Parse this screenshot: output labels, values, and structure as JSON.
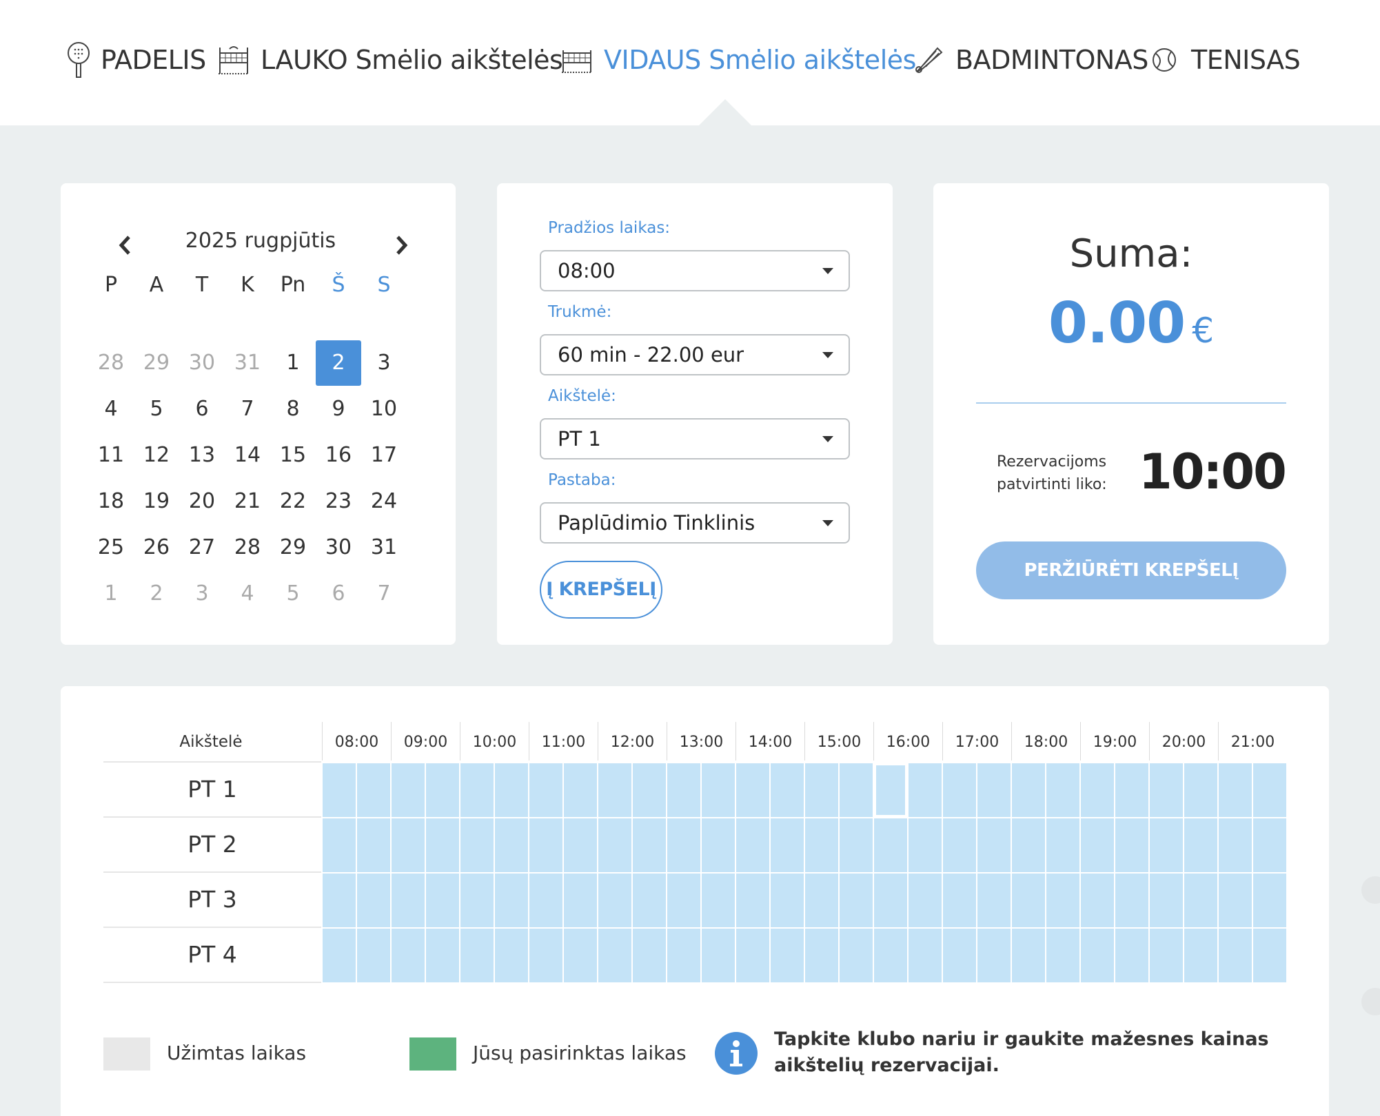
{
  "nav": {
    "items": [
      {
        "label": "PADELIS",
        "icon": "padel-racket-icon"
      },
      {
        "label": "LAUKO Smėlio aikštelės",
        "icon": "volleyball-net-icon"
      },
      {
        "label": "VIDAUS Smėlio aikštelės",
        "icon": "volleyball-net-icon",
        "active": true
      },
      {
        "label": "BADMINTONAS",
        "icon": "shuttlecock-icon"
      },
      {
        "label": "TENISAS",
        "icon": "tennis-ball-icon"
      }
    ]
  },
  "calendar": {
    "title": "2025 rugpjūtis",
    "weekdays": [
      "P",
      "A",
      "T",
      "K",
      "Pn",
      "Š",
      "S"
    ],
    "selected_day": "2",
    "weeks": [
      [
        "28",
        "29",
        "30",
        "31",
        "1",
        "2",
        "3"
      ],
      [
        "4",
        "5",
        "6",
        "7",
        "8",
        "9",
        "10"
      ],
      [
        "11",
        "12",
        "13",
        "14",
        "15",
        "16",
        "17"
      ],
      [
        "18",
        "19",
        "20",
        "21",
        "22",
        "23",
        "24"
      ],
      [
        "25",
        "26",
        "27",
        "28",
        "29",
        "30",
        "31"
      ],
      [
        "1",
        "2",
        "3",
        "4",
        "5",
        "6",
        "7"
      ]
    ]
  },
  "form": {
    "start_label": "Pradžios laikas:",
    "start_value": "08:00",
    "duration_label": "Trukmė:",
    "duration_value": "60 min - 22.00 eur",
    "court_label": "Aikštelė:",
    "court_value": "PT 1",
    "note_label": "Pastaba:",
    "note_value": "Paplūdimio Tinklinis",
    "add_button": "Į KREPŠELĮ"
  },
  "summary": {
    "label": "Suma:",
    "amount": "0.00",
    "currency": "€",
    "timer_label_1": "Rezervacijoms",
    "timer_label_2": "patvirtinti liko:",
    "timer": "10:00",
    "view_button": "PERŽIŪRĖTI KREPŠELĮ"
  },
  "schedule": {
    "court_header": "Aikštelė",
    "times": [
      "08:00",
      "09:00",
      "10:00",
      "11:00",
      "12:00",
      "13:00",
      "14:00",
      "15:00",
      "16:00",
      "17:00",
      "18:00",
      "19:00",
      "20:00",
      "21:00"
    ],
    "courts": [
      "PT 1",
      "PT 2",
      "PT 3",
      "PT 4"
    ],
    "highlighted_slot": {
      "court": "PT 1",
      "time": "16:00"
    }
  },
  "legend": {
    "busy": "Užimtas laikas",
    "busy_color": "#e8e8e8",
    "selected": "Jūsų pasirinktas laikas",
    "selected_color": "#5db37e",
    "info": "Tapkite klubo nariu ir gaukite mažesnes kainas aikštelių rezervacijai."
  },
  "colors": {
    "accent": "#4a90d9",
    "free_slot": "#c4e3f7"
  }
}
